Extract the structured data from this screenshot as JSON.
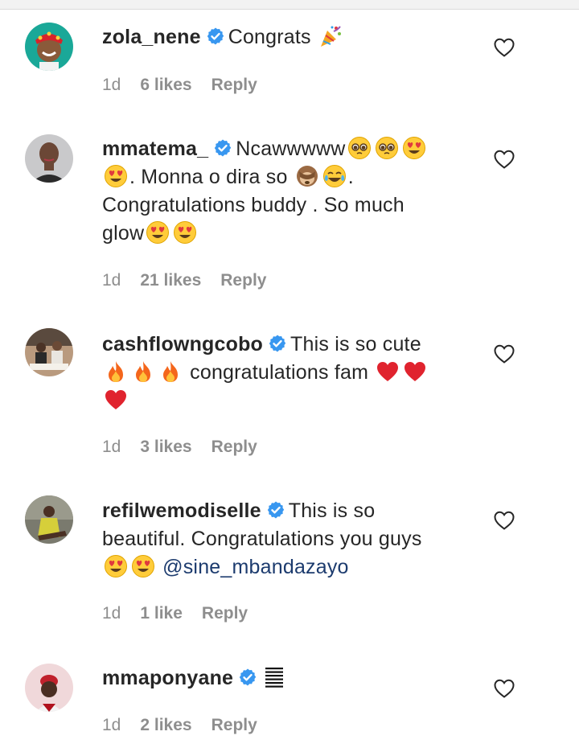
{
  "comments": [
    {
      "username": "zola_nene",
      "avatar": "zola-avatar",
      "parts": [
        {
          "t": "Congrats "
        },
        {
          "e": "party-popper"
        }
      ],
      "time": "1d",
      "likes": "6 likes",
      "reply": "Reply"
    },
    {
      "username": "mmatema_",
      "avatar": "mmatema-avatar",
      "parts": [
        {
          "t": "Ncawwwww"
        },
        {
          "e": "pleading-face"
        },
        {
          "e": "pleading-face"
        },
        {
          "e": "heart-eyes"
        },
        {
          "br": true
        },
        {
          "e": "heart-eyes"
        },
        {
          "t": ". Monna o dira so "
        },
        {
          "e": "see-no-evil-monkey"
        },
        {
          "e": "tears-of-joy"
        },
        {
          "t": "."
        },
        {
          "br": true
        },
        {
          "t": "Congratulations buddy . So much"
        },
        {
          "br": true
        },
        {
          "t": "glow"
        },
        {
          "e": "heart-eyes"
        },
        {
          "e": "heart-eyes"
        }
      ],
      "time": "1d",
      "likes": "21 likes",
      "reply": "Reply"
    },
    {
      "username": "cashflowngcobo",
      "avatar": "cashflow-avatar",
      "parts": [
        {
          "t": "This is so cute"
        },
        {
          "br": true
        },
        {
          "e": "fire"
        },
        {
          "e": "fire"
        },
        {
          "e": "fire"
        },
        {
          "t": " congratulations fam "
        },
        {
          "e": "red-heart"
        },
        {
          "e": "red-heart"
        },
        {
          "br": true
        },
        {
          "e": "red-heart"
        }
      ],
      "time": "1d",
      "likes": "3 likes",
      "reply": "Reply"
    },
    {
      "username": "refilwemodiselle",
      "avatar": "refilwe-avatar",
      "parts": [
        {
          "t": "This is so"
        },
        {
          "br": true
        },
        {
          "t": "beautiful. Congratulations you guys"
        },
        {
          "br": true
        },
        {
          "e": "heart-eyes"
        },
        {
          "e": "heart-eyes"
        },
        {
          "t": " "
        },
        {
          "m": "@sine_mbandazayo"
        }
      ],
      "time": "1d",
      "likes": "1 like",
      "reply": "Reply"
    },
    {
      "username": "mmaponyane",
      "avatar": "mmaponyane-avatar",
      "parts": [
        {
          "e": "stacked-lines"
        }
      ],
      "time": "1d",
      "likes": "2 likes",
      "reply": "Reply"
    }
  ],
  "colors": {
    "text": "#262626",
    "meta": "#8e8e8e",
    "verified": "#3897f0",
    "mention": "#1c3b6e"
  }
}
